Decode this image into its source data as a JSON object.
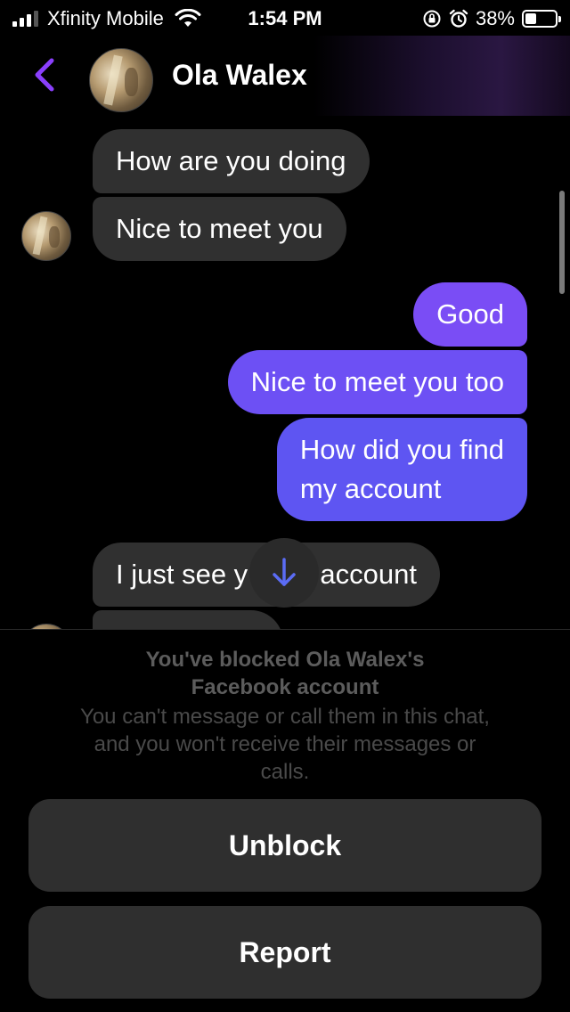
{
  "status_bar": {
    "carrier": "Xfinity Mobile",
    "time": "1:54 PM",
    "battery_percent": "38%",
    "battery_level": 0.38,
    "icons": [
      "signal-icon",
      "wifi-icon",
      "orientation-lock-icon",
      "alarm-icon",
      "battery-icon"
    ]
  },
  "header": {
    "contact_name": "Ola Walex",
    "back_icon": "chevron-left-icon"
  },
  "messages": [
    {
      "direction": "incoming",
      "text": "How are you doing"
    },
    {
      "direction": "incoming",
      "text": "Nice to meet you"
    },
    {
      "direction": "outgoing",
      "text": "Good"
    },
    {
      "direction": "outgoing",
      "text": "Nice to meet you too"
    },
    {
      "direction": "outgoing",
      "lines": [
        "How did you find",
        "my account"
      ]
    },
    {
      "direction": "incoming",
      "text": "I just see your account",
      "visible_left": "I just see y",
      "visible_right": "account"
    }
  ],
  "blocked_notice": {
    "title_line1": "You've blocked Ola Walex's",
    "title_line2": "Facebook account",
    "desc_line1": "You can't message or call them in this chat,",
    "desc_line2": "and you won't receive their messages or",
    "desc_line3": "calls."
  },
  "actions": {
    "unblock_label": "Unblock",
    "report_label": "Report"
  },
  "colors": {
    "accent": "#8a3ffc",
    "outgoing_top": "#7b4cf5",
    "outgoing_bottom": "#5a55f0",
    "incoming_bubble": "#303030",
    "scroll_arrow": "#5b6cf5"
  }
}
